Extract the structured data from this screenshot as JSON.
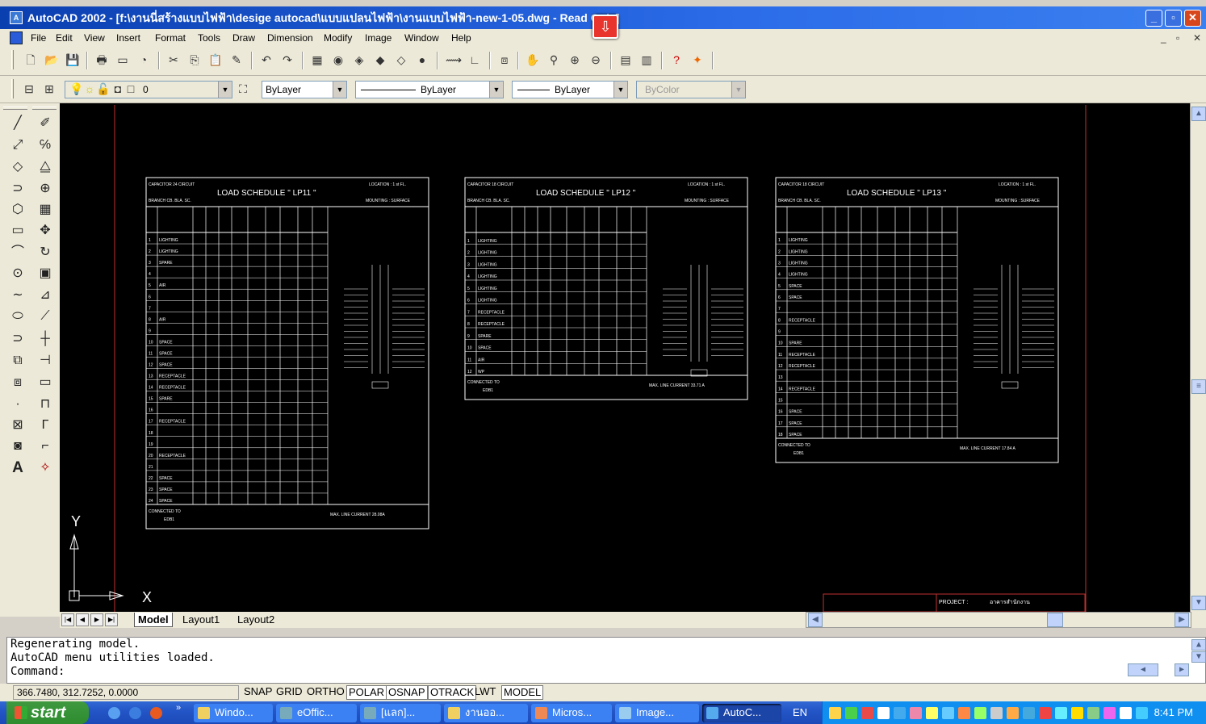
{
  "window": {
    "title": "AutoCAD 2002 - [f:\\งานนี่สร้างแบบไฟฟ้า\\desige autocad\\แบบแปลนไฟฟ้า\\งานแบบไฟฟ้า-new-1-05.dwg - Read Only]",
    "min": "_",
    "max": "▫",
    "close": "✕"
  },
  "menu": [
    "File",
    "Edit",
    "View",
    "Insert",
    "Format",
    "Tools",
    "Draw",
    "Dimension",
    "Modify",
    "Image",
    "Window",
    "Help"
  ],
  "layers": {
    "layer_name": "0",
    "color": "ByLayer",
    "linetype": "ByLayer",
    "lineweight": "ByLayer",
    "plotstyle": "ByColor"
  },
  "drawing": {
    "schedules": [
      {
        "cap": "CAPACITOR 24 CIRCUIT",
        "title": "LOAD SCHEDULE  \" LP11 \"",
        "loc": "LOCATION : 1 st FL.",
        "branch": "BRANCH CB. BLA. SC.",
        "mount": "MOUNTING : SURFACE",
        "cur": "MAX. LINE CURRENT 28.08A",
        "conn": "CONNECTED TO",
        "feeder": "EDB1",
        "rows": [
          "LIGHTING",
          "LIGHTING",
          "SPARE",
          "",
          "AIR",
          "",
          "",
          "AIR",
          "",
          "SPACE",
          "SPACE",
          "SPACE",
          "RECEPTACLE",
          "RECEPTACLE",
          "SPARE",
          "",
          "RECEPTACLE",
          "",
          "",
          "RECEPTACLE",
          "",
          "SPACE",
          "SPACE",
          "SPACE"
        ]
      },
      {
        "cap": "CAPACITOR 18 CIRCUIT",
        "title": "LOAD SCHEDULE  \" LP12 \"",
        "loc": "LOCATION : 1 st FL.",
        "branch": "BRANCH CB. BLA. SC.",
        "mount": "MOUNTING : SURFACE",
        "cur": "MAX. LINE CURRENT 33.71 A",
        "conn": "CONNECTED TO",
        "feeder": "EDB1",
        "rows": [
          "LIGHTING",
          "LIGHTING",
          "LIGHTING",
          "LIGHTING",
          "LIGHTING",
          "LIGHTING",
          "RECEPTACLE",
          "RECEPTACLE",
          "SPARE",
          "SPACE",
          "AIR",
          "WP"
        ]
      },
      {
        "cap": "CAPACITOR 18 CIRCUIT",
        "title": "LOAD SCHEDULE  \" LP13 \"",
        "loc": "LOCATION : 1 st FL.",
        "branch": "BRANCH CB. BLA. SC.",
        "mount": "MOUNTING : SURFACE",
        "cur": "MAX. LINE CURRENT 17.84 A",
        "conn": "CONNECTED TO",
        "feeder": "EDB1",
        "rows": [
          "LIGHTING",
          "LIGHTING",
          "LIGHTING",
          "LIGHTING",
          "SPACE",
          "SPACE",
          "",
          "RECEPTACLE",
          "",
          "SPARE",
          "RECEPTACLE",
          "RECEPTACLE",
          "",
          "RECEPTACLE",
          "",
          "SPACE",
          "SPACE",
          "SPACE"
        ]
      }
    ],
    "title_block": {
      "project_label": "PROJECT :",
      "project_value": "อาคารสำนักงาน"
    },
    "ucs": {
      "y": "Y",
      "x": "X"
    }
  },
  "tabs": {
    "model": "Model",
    "layout1": "Layout1",
    "layout2": "Layout2"
  },
  "command": {
    "lines": [
      "Regenerating model.",
      "AutoCAD menu utilities loaded.",
      "Command:"
    ]
  },
  "status": {
    "coords": "366.7480, 312.7252, 0.0000",
    "toggles": [
      "SNAP",
      "GRID",
      "ORTHO",
      "POLAR",
      "OSNAP",
      "OTRACK",
      "LWT",
      "MODEL"
    ]
  },
  "taskbar": {
    "start": "start",
    "tasks": [
      "Windo...",
      "eOffic...",
      "[แลก]...",
      "งานออ...",
      "Micros...",
      "Image...",
      "AutoC..."
    ],
    "lang": "EN",
    "clock": "8:41 PM"
  }
}
